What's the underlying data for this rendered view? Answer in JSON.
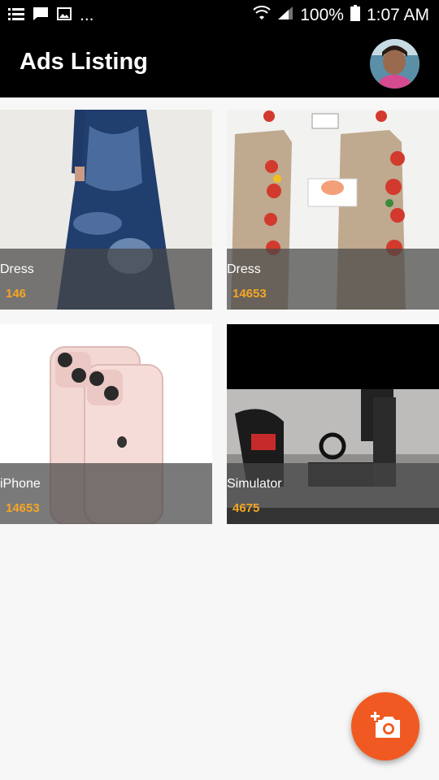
{
  "status_bar": {
    "icons_left": [
      "list-icon",
      "chat-icon",
      "image-icon"
    ],
    "more": "...",
    "battery": "100%",
    "time": "1:07 AM"
  },
  "app_bar": {
    "title": "Ads Listing",
    "avatar_icon": "profile-avatar"
  },
  "ads": [
    {
      "title": "Dress",
      "price": "146"
    },
    {
      "title": "Dress",
      "price": "14653"
    },
    {
      "title": "iPhone",
      "price": "14653"
    },
    {
      "title": "Simulator",
      "price": "4675"
    }
  ],
  "fab": {
    "icon": "add-photo-icon"
  },
  "colors": {
    "accent": "#f05a22",
    "price": "#f5a623",
    "bar": "#000000"
  }
}
